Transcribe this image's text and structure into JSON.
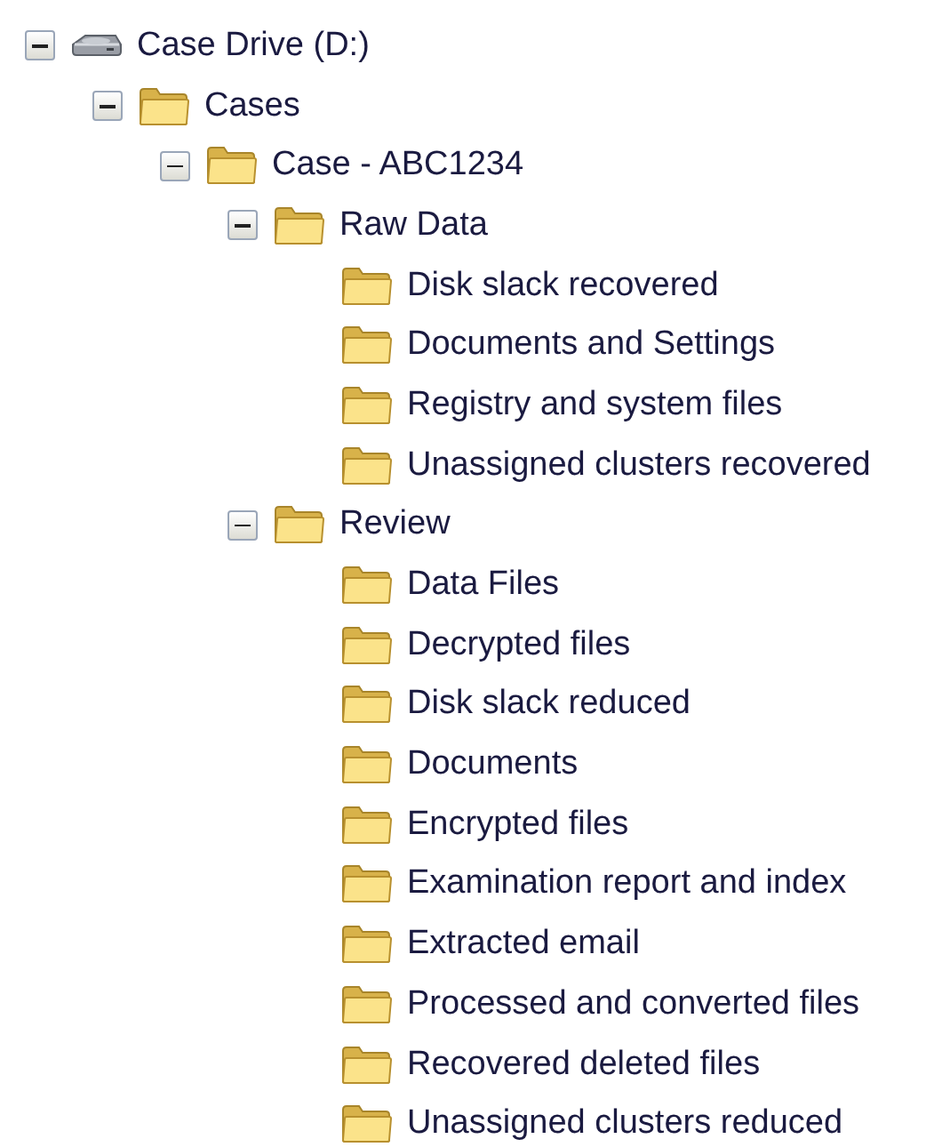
{
  "tree": [
    {
      "kind": "drive",
      "label": "Case Drive (D:)",
      "expanded": true,
      "children": [
        {
          "kind": "folder",
          "label": "Cases",
          "expanded": true,
          "children": [
            {
              "kind": "folder",
              "label": "Case - ABC1234",
              "expanded": true,
              "children": [
                {
                  "kind": "folder",
                  "label": "Raw Data",
                  "expanded": true,
                  "children": [
                    {
                      "kind": "folder",
                      "label": "Disk slack recovered"
                    },
                    {
                      "kind": "folder",
                      "label": "Documents and Settings"
                    },
                    {
                      "kind": "folder",
                      "label": "Registry and system files"
                    },
                    {
                      "kind": "folder",
                      "label": "Unassigned clusters recovered"
                    }
                  ]
                },
                {
                  "kind": "folder",
                  "label": "Review",
                  "expanded": true,
                  "children": [
                    {
                      "kind": "folder",
                      "label": "Data Files"
                    },
                    {
                      "kind": "folder",
                      "label": "Decrypted files"
                    },
                    {
                      "kind": "folder",
                      "label": "Disk slack reduced"
                    },
                    {
                      "kind": "folder",
                      "label": "Documents"
                    },
                    {
                      "kind": "folder",
                      "label": "Encrypted files"
                    },
                    {
                      "kind": "folder",
                      "label": "Examination report and index"
                    },
                    {
                      "kind": "folder",
                      "label": "Extracted email"
                    },
                    {
                      "kind": "folder",
                      "label": "Processed and converted files"
                    },
                    {
                      "kind": "folder",
                      "label": "Recovered deleted files"
                    },
                    {
                      "kind": "folder",
                      "label": "Unassigned clusters reduced"
                    }
                  ]
                }
              ]
            }
          ]
        }
      ]
    }
  ]
}
